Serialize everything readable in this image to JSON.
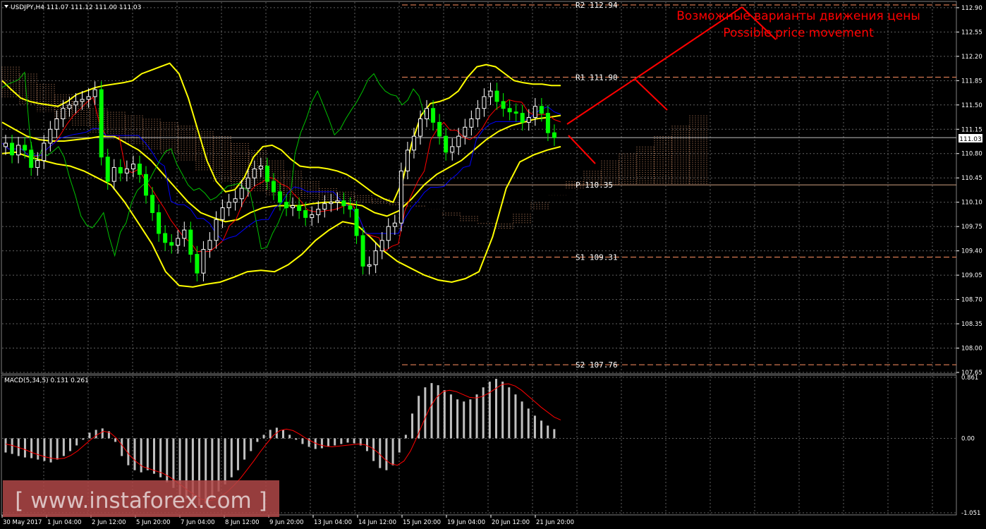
{
  "symbol_header": "USDJPY,H4  111.07 111.12 111.00 111.03",
  "current_price_label": "111.03",
  "annotation": {
    "ru": "Возможные варианты движения цены",
    "en": "Possible price movement",
    "color": "#ff0000"
  },
  "watermark": "[ www.instaforex.com ]",
  "macd_header": "MACD(5,34,5) 0.131 0.261",
  "colors": {
    "background": "#000000",
    "grid": "#606060",
    "bull_candle": "#ffffff",
    "bear_candle": "#00ff00",
    "bollinger": "#ffff00",
    "tenkan": "#ff0000",
    "kijun": "#0000ff",
    "chikou": "#00c000",
    "kumo": "#ffb080",
    "pivot_levels": "#ff9060",
    "macd_hist": "#c0c0c0",
    "macd_signal": "#ff0000",
    "annotation": "#ff0000"
  },
  "chart_data": [
    {
      "type": "line",
      "name": "USDJPY H4 price chart",
      "ylim": [
        107.65,
        112.96
      ],
      "y_ticks": [
        "112.90",
        "112.55",
        "112.20",
        "111.85",
        "111.50",
        "111.15",
        "110.80",
        "110.45",
        "110.10",
        "109.75",
        "109.40",
        "109.05",
        "108.70",
        "108.35",
        "108.00",
        "107.65"
      ],
      "x_ticks": [
        "30 May 2017",
        "1 Jun 04:00",
        "2 Jun 12:00",
        "5 Jun 20:00",
        "7 Jun 04:00",
        "8 Jun 12:00",
        "9 Jun 20:00",
        "13 Jun 04:00",
        "14 Jun 12:00",
        "15 Jun 20:00",
        "19 Jun 04:00",
        "20 Jun 12:00",
        "21 Jun 20:00"
      ],
      "levels": [
        {
          "label": "R2 112.94",
          "value": 112.94
        },
        {
          "label": "R1 111.90",
          "value": 111.9
        },
        {
          "label": "P 110.35",
          "value": 110.35
        },
        {
          "label": "S1 109.31",
          "value": 109.31
        },
        {
          "label": "S2 107.76",
          "value": 107.76
        }
      ],
      "close_series": [
        110.95,
        110.78,
        110.92,
        110.85,
        110.6,
        110.7,
        110.95,
        111.15,
        111.3,
        111.45,
        111.5,
        111.55,
        111.58,
        111.62,
        111.72,
        110.75,
        110.4,
        110.6,
        110.52,
        110.58,
        110.65,
        110.5,
        110.2,
        109.95,
        109.65,
        109.52,
        109.48,
        109.58,
        109.7,
        109.35,
        109.08,
        109.42,
        109.55,
        109.85,
        110.02,
        110.1,
        110.15,
        110.3,
        110.45,
        110.58,
        110.62,
        110.4,
        110.25,
        110.1,
        110.02,
        110.05,
        109.98,
        109.88,
        109.92,
        110.0,
        110.08,
        110.1,
        110.12,
        110.05,
        110.0,
        109.62,
        109.18,
        109.2,
        109.4,
        109.55,
        109.75,
        109.8,
        110.55,
        110.85,
        111.05,
        111.3,
        111.45,
        111.25,
        111.05,
        110.82,
        110.9,
        111.05,
        111.18,
        111.3,
        111.45,
        111.62,
        111.7,
        111.55,
        111.45,
        111.4,
        111.38,
        111.25,
        111.32,
        111.48,
        111.38,
        111.1,
        111.03
      ],
      "bollinger_upper": [
        111.85,
        111.72,
        111.6,
        111.55,
        111.52,
        111.5,
        111.48,
        111.55,
        111.65,
        111.7,
        111.75,
        111.78,
        111.8,
        111.82,
        111.85,
        111.95,
        112.0,
        112.05,
        112.1,
        111.95,
        111.6,
        111.15,
        110.7,
        110.4,
        110.25,
        110.28,
        110.45,
        110.75,
        110.9,
        110.92,
        110.85,
        110.72,
        110.62,
        110.6,
        110.6,
        110.58,
        110.55,
        110.5,
        110.42,
        110.32,
        110.22,
        110.15,
        110.1,
        110.4,
        110.95,
        111.35,
        111.52,
        111.55,
        111.6,
        111.7,
        111.9,
        112.05,
        112.08,
        112.05,
        111.95,
        111.85,
        111.82,
        111.8,
        111.8,
        111.78,
        111.78
      ],
      "bollinger_middle": [
        111.25,
        111.15,
        111.05,
        111.0,
        110.98,
        110.98,
        111.0,
        111.02,
        111.05,
        111.05,
        110.95,
        110.85,
        110.7,
        110.5,
        110.3,
        110.1,
        109.95,
        109.88,
        109.82,
        109.85,
        109.95,
        110.02,
        110.05,
        110.05,
        110.05,
        110.08,
        110.1,
        110.1,
        110.08,
        110.05,
        109.95,
        109.9,
        109.98,
        110.15,
        110.35,
        110.5,
        110.6,
        110.7,
        110.85,
        111.0,
        111.12,
        111.2,
        111.25,
        111.3,
        111.32,
        111.35
      ],
      "bollinger_lower": [
        110.8,
        110.82,
        110.75,
        110.7,
        110.65,
        110.62,
        110.55,
        110.45,
        110.35,
        110.1,
        109.8,
        109.5,
        109.1,
        108.9,
        108.88,
        108.92,
        108.95,
        109.02,
        109.1,
        109.12,
        109.1,
        109.2,
        109.35,
        109.55,
        109.7,
        109.82,
        109.78,
        109.6,
        109.4,
        109.25,
        109.15,
        109.05,
        108.98,
        108.95,
        109.0,
        109.1,
        109.6,
        110.3,
        110.68,
        110.78,
        110.85,
        110.9
      ],
      "macd": {
        "name": "MACD(5,34,5)",
        "ylim": [
          -1.051,
          0.861
        ],
        "y_ticks": [
          "0.861",
          "0.00",
          "-1.051"
        ],
        "histogram": [
          -0.2,
          -0.22,
          -0.25,
          -0.27,
          -0.28,
          -0.3,
          -0.32,
          -0.34,
          -0.3,
          -0.25,
          -0.18,
          -0.1,
          -0.02,
          0.08,
          0.12,
          0.14,
          0.1,
          -0.05,
          -0.25,
          -0.38,
          -0.45,
          -0.48,
          -0.45,
          -0.5,
          -0.55,
          -0.62,
          -0.7,
          -0.8,
          -0.85,
          -0.9,
          -0.95,
          -0.92,
          -0.85,
          -0.75,
          -0.65,
          -0.55,
          -0.45,
          -0.3,
          -0.18,
          -0.05,
          0.05,
          0.12,
          0.15,
          0.12,
          0.05,
          -0.02,
          -0.08,
          -0.12,
          -0.15,
          -0.14,
          -0.12,
          -0.1,
          -0.08,
          -0.06,
          -0.07,
          -0.1,
          -0.18,
          -0.32,
          -0.42,
          -0.45,
          -0.38,
          -0.2,
          0.05,
          0.35,
          0.6,
          0.72,
          0.78,
          0.75,
          0.68,
          0.62,
          0.55,
          0.52,
          0.55,
          0.62,
          0.72,
          0.8,
          0.84,
          0.8,
          0.72,
          0.62,
          0.52,
          0.42,
          0.32,
          0.25,
          0.18,
          0.13
        ],
        "signal": [
          -0.08,
          -0.1,
          -0.13,
          -0.16,
          -0.2,
          -0.23,
          -0.26,
          -0.28,
          -0.29,
          -0.28,
          -0.24,
          -0.18,
          -0.1,
          -0.02,
          0.05,
          0.1,
          0.08,
          0.0,
          -0.12,
          -0.24,
          -0.33,
          -0.4,
          -0.43,
          -0.46,
          -0.49,
          -0.54,
          -0.6,
          -0.67,
          -0.74,
          -0.8,
          -0.86,
          -0.88,
          -0.87,
          -0.82,
          -0.75,
          -0.66,
          -0.56,
          -0.44,
          -0.32,
          -0.19,
          -0.07,
          0.04,
          0.11,
          0.13,
          0.11,
          0.06,
          0.0,
          -0.05,
          -0.09,
          -0.11,
          -0.12,
          -0.11,
          -0.1,
          -0.09,
          -0.08,
          -0.09,
          -0.13,
          -0.2,
          -0.29,
          -0.36,
          -0.38,
          -0.32,
          -0.18,
          0.02,
          0.24,
          0.44,
          0.58,
          0.66,
          0.68,
          0.66,
          0.62,
          0.58,
          0.57,
          0.59,
          0.64,
          0.7,
          0.76,
          0.77,
          0.74,
          0.68,
          0.6,
          0.52,
          0.44,
          0.37,
          0.3,
          0.26
        ]
      }
    }
  ]
}
